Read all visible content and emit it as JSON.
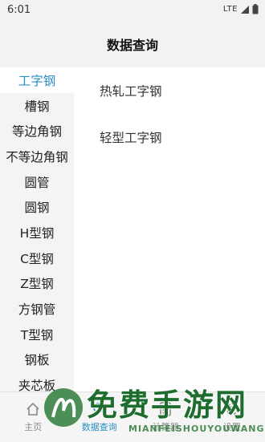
{
  "status_bar": {
    "time": "6:01",
    "network": "LTE"
  },
  "app_bar": {
    "title": "数据查询"
  },
  "sidebar": {
    "items": [
      {
        "label": "工字钢",
        "active": true
      },
      {
        "label": "槽钢"
      },
      {
        "label": "等边角钢"
      },
      {
        "label": "不等边角钢"
      },
      {
        "label": "圆管"
      },
      {
        "label": "圆钢"
      },
      {
        "label": "H型钢"
      },
      {
        "label": "C型钢"
      },
      {
        "label": "Z型钢"
      },
      {
        "label": "方钢管"
      },
      {
        "label": "T型钢"
      },
      {
        "label": "钢板"
      },
      {
        "label": "夹芯板"
      }
    ]
  },
  "content": {
    "items": [
      {
        "label": "热轧工字钢"
      },
      {
        "label": "轻型工字钢"
      }
    ]
  },
  "bottom_nav": {
    "tabs": [
      {
        "label": "主页",
        "icon": "home-icon"
      },
      {
        "label": "数据查询",
        "icon": "search-icon",
        "active": true
      },
      {
        "label": "计算器",
        "icon": "calculator-icon"
      },
      {
        "label": "设置",
        "icon": "settings-icon"
      }
    ]
  },
  "watermark": {
    "title": "免费手游网",
    "subtitle": "MIANFEISHOUYOUWANG"
  },
  "colors": {
    "accent": "#2a8fc4",
    "watermark": "#1e6d2e"
  }
}
